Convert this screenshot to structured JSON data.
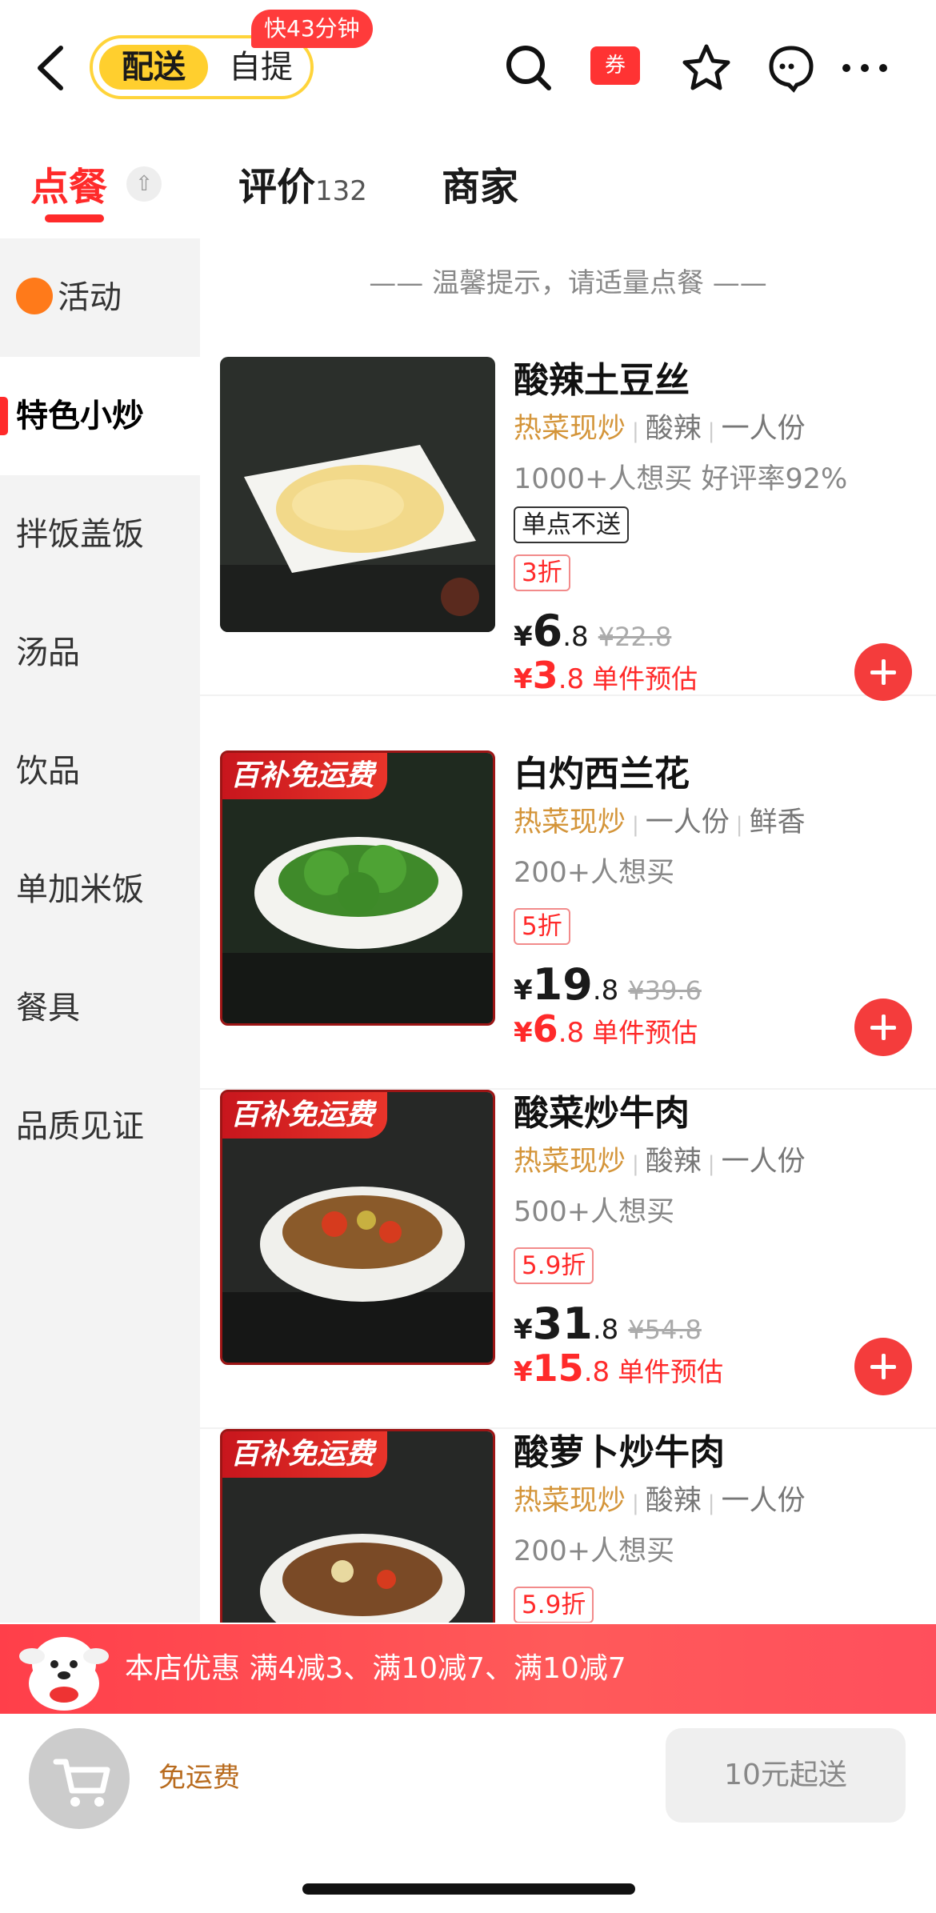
{
  "header": {
    "mode_delivery": "配送",
    "mode_pickup": "自提",
    "fast_badge": "快43分钟",
    "coupon_label": "券"
  },
  "tabs": [
    {
      "label": "点餐",
      "count": ""
    },
    {
      "label": "评价",
      "count": "132"
    },
    {
      "label": "商家",
      "count": ""
    }
  ],
  "sidebar": {
    "items": [
      {
        "label": "活动"
      },
      {
        "label": "特色小炒"
      },
      {
        "label": "拌饭盖饭"
      },
      {
        "label": "汤品"
      },
      {
        "label": "饮品"
      },
      {
        "label": "单加米饭"
      },
      {
        "label": "餐具"
      },
      {
        "label": "品质见证"
      }
    ]
  },
  "tip": "—— 温馨提示，请适量点餐 ——",
  "products": [
    {
      "name": "酸辣土豆丝",
      "tags": [
        "热菜现炒",
        "酸辣",
        "一人份"
      ],
      "stats": "1000+人想买  好评率92%",
      "badge": "单点不送",
      "subsidy": "",
      "discount": "3折",
      "price_yen": "¥",
      "price_int": "6",
      "price_dec": ".8",
      "price_old": "¥22.8",
      "est_int": "3",
      "est_dec": ".8",
      "est_label": "单件预估"
    },
    {
      "name": "白灼西兰花",
      "tags": [
        "热菜现炒",
        "一人份",
        "鲜香"
      ],
      "stats": "200+人想买",
      "badge": "",
      "subsidy": "百补免运费",
      "discount": "5折",
      "price_yen": "¥",
      "price_int": "19",
      "price_dec": ".8",
      "price_old": "¥39.6",
      "est_int": "6",
      "est_dec": ".8",
      "est_label": "单件预估"
    },
    {
      "name": "酸菜炒牛肉",
      "tags": [
        "热菜现炒",
        "酸辣",
        "一人份"
      ],
      "stats": "500+人想买",
      "badge": "",
      "subsidy": "百补免运费",
      "discount": "5.9折",
      "price_yen": "¥",
      "price_int": "31",
      "price_dec": ".8",
      "price_old": "¥54.8",
      "est_int": "15",
      "est_dec": ".8",
      "est_label": "单件预估"
    },
    {
      "name": "酸萝卜炒牛肉",
      "tags": [
        "热菜现炒",
        "酸辣",
        "一人份"
      ],
      "stats": "200+人想买",
      "badge": "",
      "subsidy": "百补免运费",
      "discount": "5.9折"
    }
  ],
  "promo": {
    "text": "本店优惠  满4减3、满10减7、满10减7"
  },
  "bottom": {
    "free_shipping": "免运费",
    "min_order": "10元起送"
  },
  "colors": {
    "accent": "#ff2a2a",
    "mode_yellow": "#ffcf2e",
    "tag_hot": "#d4953a"
  }
}
